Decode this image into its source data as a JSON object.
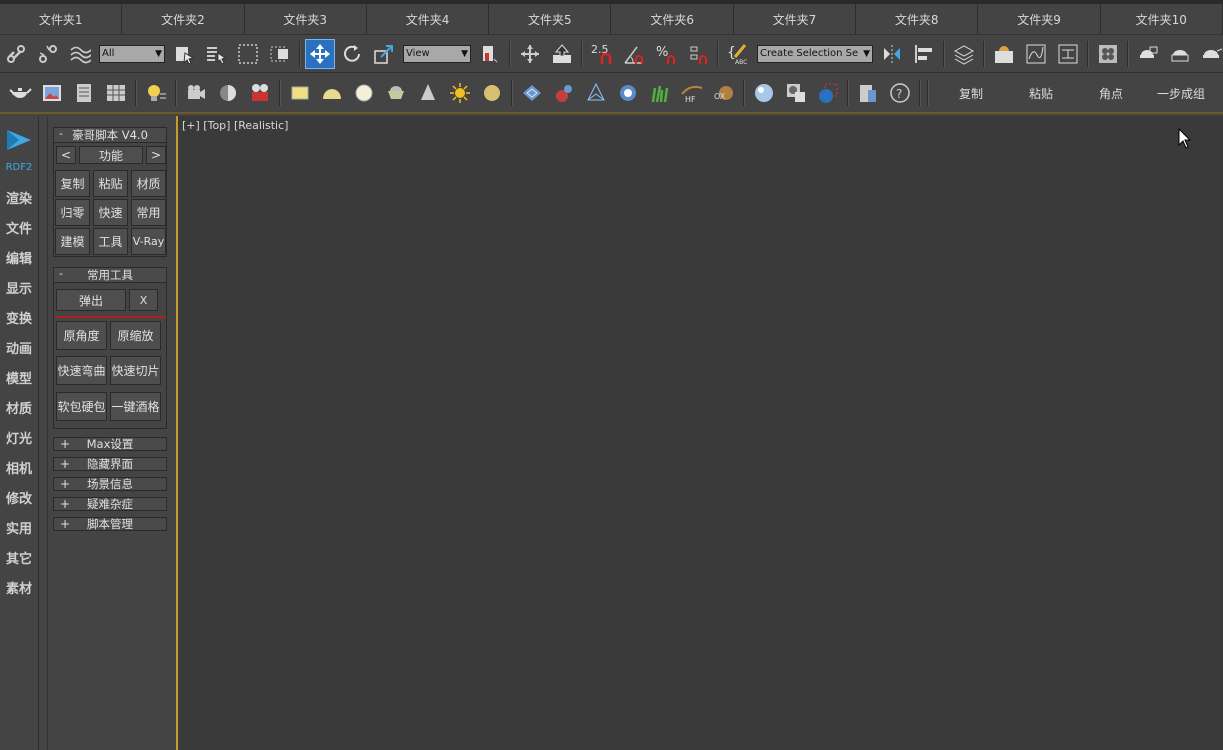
{
  "folder_tabs": [
    "文件夹1",
    "文件夹2",
    "文件夹3",
    "文件夹4",
    "文件夹5",
    "文件夹6",
    "文件夹7",
    "文件夹8",
    "文件夹9",
    "文件夹10"
  ],
  "toolbar1": {
    "selection_filter": "All",
    "ref_coord": "View",
    "snap_angle_label": "2.5",
    "selection_set": "Create Selection Se"
  },
  "toolbar2": {
    "text_buttons": [
      "复制",
      "粘贴",
      "角点",
      "一步成组"
    ]
  },
  "rail": {
    "brand": "RDF2",
    "items": [
      "渲染",
      "文件",
      "编辑",
      "显示",
      "变换",
      "动画",
      "模型",
      "材质",
      "灯光",
      "相机",
      "修改",
      "实用",
      "其它",
      "素材"
    ]
  },
  "panel": {
    "script_title": "豪哥脚本 V4.0",
    "nav_prev": "<",
    "nav_label": "功能",
    "nav_next": ">",
    "grid_buttons": [
      "复制",
      "粘贴",
      "材质",
      "归零",
      "快速",
      "常用",
      "建模",
      "工具",
      "V-Ray"
    ],
    "tools_title": "常用工具",
    "popup_label": "弹出",
    "close_label": "X",
    "tool_buttons": [
      "原角度",
      "原缩放",
      "快速弯曲",
      "快速切片",
      "软包硬包",
      "一键酒格"
    ],
    "collapsed": [
      "Max设置",
      "隐藏界面",
      "场景信息",
      "疑难杂症",
      "脚本管理"
    ],
    "minus": "-",
    "plus": "+"
  },
  "viewport": {
    "label": "[+] [Top] [Realistic]"
  },
  "colors": {
    "accent_blue": "#2a70c0",
    "viewport_border": "#c89a2a",
    "brand_blue": "#3fa8e0"
  }
}
